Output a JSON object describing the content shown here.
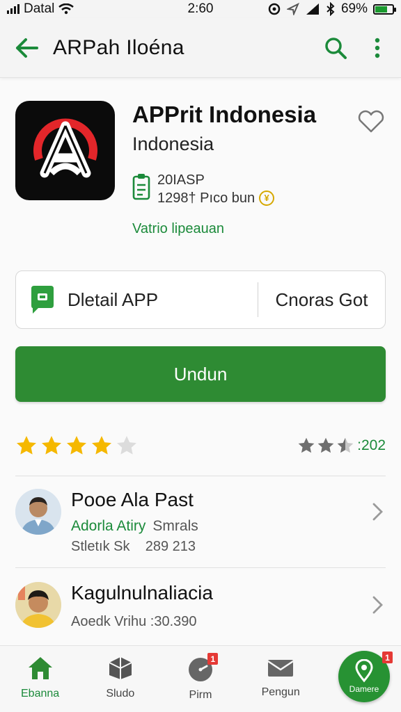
{
  "status_bar": {
    "carrier": "Datal",
    "time": "2:60",
    "battery": "69%",
    "battery_level": 0.69
  },
  "app_bar": {
    "title": "ARPah Iloéna",
    "back_icon": "arrow-left-icon",
    "search_icon": "search-icon",
    "menu_icon": "more-vert-icon"
  },
  "app": {
    "name": "APPrit Indonesia",
    "subtitle": "Indonesia",
    "meta_line1": "20IASP",
    "meta_line2": "1298† Pıco bun",
    "tag": "Vatrio lipeauan"
  },
  "detail_card": {
    "left_label": "Dletail APP",
    "right_label": "Cnoras Got"
  },
  "install_button": {
    "label": "Undun"
  },
  "rating": {
    "stars": 4,
    "max_stars": 5,
    "summary_stars": 2.5,
    "count": ":202"
  },
  "list": [
    {
      "title": "Pooe Ala Past",
      "green": "Adorla Atiry",
      "green_secondary": "Smrals",
      "gray": "Stletık Sk    289 213"
    },
    {
      "title": "Kagulnulnaliacia",
      "gray": "Aoedk Vrihu :30.390"
    }
  ],
  "nav": {
    "items": [
      {
        "label": "Ebanna",
        "icon": "home-icon",
        "active": true
      },
      {
        "label": "Sludo",
        "icon": "cube-icon",
        "active": false
      },
      {
        "label": "Pirm",
        "icon": "timer-icon",
        "badge": "1",
        "active": false
      },
      {
        "label": "Pengun",
        "icon": "mail-icon",
        "active": false
      }
    ],
    "fab": {
      "label": "Damere",
      "icon": "location-pin-icon",
      "badge": "1"
    }
  },
  "colors": {
    "accent": "#2e8b33",
    "link": "#1b8a3a",
    "star": "#f5b800",
    "badge": "#e53935"
  }
}
